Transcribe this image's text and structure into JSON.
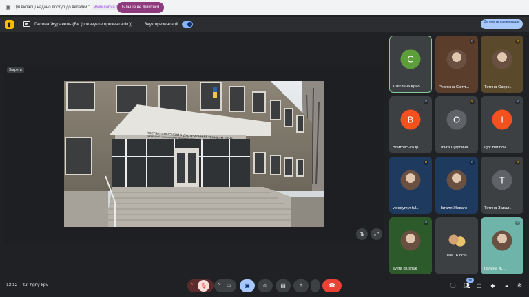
{
  "share_bar": {
    "message": "Цій вкладці надано доступ до вкладки \"",
    "url": "www.canva.com",
    "suffix": "\"",
    "stop_button": "Більше не ділитися"
  },
  "presentation_bar": {
    "presenter": "Галина Журавель (Ви (показуєте презентацію))",
    "sound_label": "Звук презентації",
    "sound_on": true,
    "stop_button": "Зупинити презентацію"
  },
  "stage": {
    "label": "Закрити",
    "building_sign_line1": "КОСТЯНТИНІВСЬКИЙ ІНДУСТРІАЛЬНИЙ ТЕХНІКУМ ДВНЗ",
    "building_sign_line2": "«Донецький національний технічний університет»"
  },
  "participants": [
    {
      "name": "Світлана Крьо...",
      "initial": "С",
      "color": "#5e9e3a",
      "mic": "talking"
    },
    {
      "name": "Ревякіна Світл...",
      "initial": "",
      "color": "#5a3e2b",
      "mic": "muted"
    },
    {
      "name": "Тетяна Озерс...",
      "initial": "",
      "color": "#5a4a2b",
      "mic": "muted"
    },
    {
      "name": "Войтовська Ір...",
      "initial": "В",
      "color": "#f4511e",
      "mic": "muted"
    },
    {
      "name": "Ольга Щербина",
      "initial": "О",
      "color": "#5f6368",
      "mic": "muted"
    },
    {
      "name": "Igor Barinov",
      "initial": "I",
      "color": "#f4511e",
      "mic": "muted"
    },
    {
      "name": "volodymyr tul...",
      "initial": "",
      "color": "#1e3a5f",
      "mic": "muted"
    },
    {
      "name": "Наталя Жеваго",
      "initial": "",
      "color": "#1e3a5f",
      "mic": "muted"
    },
    {
      "name": "Тетяна Завал...",
      "initial": "Т",
      "color": "#5f6368",
      "mic": "muted"
    },
    {
      "name": "sveta glushuk",
      "initial": "",
      "color": "#2d5a2b",
      "mic": "muted"
    },
    {
      "name": "Ще 16 осіб",
      "initial": "",
      "color": "#3c4043",
      "mic": "none"
    },
    {
      "name": "Галина Ж...",
      "initial": "",
      "color": "#6fb4a8",
      "mic": "muted"
    }
  ],
  "bottom_bar": {
    "time": "13:12",
    "meeting_code": "tuf-hgny-kpv",
    "participants_count": "28"
  },
  "icons": {
    "mic_off": "mic-off-icon",
    "camera": "camera-icon",
    "present": "present-icon",
    "emoji": "emoji-icon",
    "captions": "captions-icon",
    "raise_hand": "hand-icon",
    "more": "more-icon",
    "hang_up": "hang-up-icon"
  },
  "colors": {
    "accent": "#8ab4f8",
    "hangup": "#ea4335",
    "share_button": "#8e3b7e",
    "active_speaker": "#81c995"
  }
}
